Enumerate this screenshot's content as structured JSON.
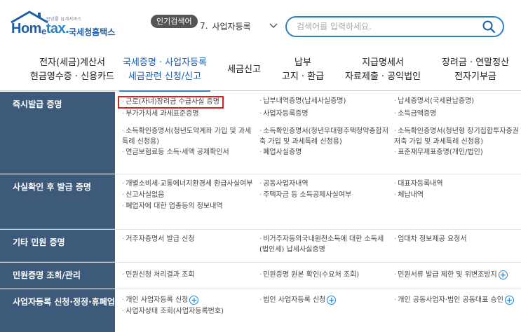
{
  "header": {
    "logo_tagline": "안녕를 납세서비스",
    "logo_brand_home": "Hom",
    "logo_brand_e": "e",
    "logo_brand_tax": "tax.",
    "logo_sub": "국세청홈택스",
    "popular_badge": "인기검색어",
    "popular_number": "7.",
    "popular_term": "사업자등록",
    "search_placeholder": "검색어를 입력하세요."
  },
  "nav": [
    {
      "line1": "전자(세금)계산서",
      "line2": "현금영수증 · 신용카드"
    },
    {
      "line1": "국세증명 · 사업자등록",
      "line2": "세금관련 신청/신고"
    },
    {
      "line1": "세금신고",
      "line2": ""
    },
    {
      "line1": "납부",
      "line2": "고지 · 환급"
    },
    {
      "line1": "지급명세서",
      "line2": "자료제출 · 공익법인"
    },
    {
      "line1": "장려금 · 연말정산",
      "line2": "전자기부금"
    }
  ],
  "sections": [
    {
      "title": "즉시발급 증명",
      "items": [
        "근로(자녀)장려금 수급사실 증명",
        "납부내역증명(납세사실증명)",
        "납세증명서(국세완납증명)",
        "부가가치세 과세표준증명",
        "사업자등록증명",
        "소득금액증명",
        "소득확인증명서(청년도약계좌 가입 및 과세특례 신청용)",
        "소득확인증명서(청년우대형주택청약종합저축 가입 및 과세특례 신청용)",
        "소득확인증명서(청년형 장기집합투자증권저축 가입 및 과세특례 신청용)",
        "연금보험료등 소득·세액 공제확인서",
        "폐업사실증명",
        "표준재무제표증명(개인/법인)"
      ]
    },
    {
      "title": "사실확인 후 발급 증명",
      "items": [
        "개별소비세·교통에너지환경세 환급사실여부",
        "공동사업자내역",
        "대표자등록내역",
        "신고사실없음",
        "주택자금 등 소득공제사실여부",
        "체납내역",
        "폐업자에 대한 업종등의 정보내역",
        "",
        ""
      ]
    },
    {
      "title": "기타 민원 증명",
      "items": [
        "거주자증명서 발급 신청",
        "비거주자등의국내원천소득에 대한 소득세(법인세) 납세사실증명",
        "임대차 정보제공 요청서"
      ]
    },
    {
      "title": "민원증명 조회/관리",
      "items": [
        "민원신청 처리결과 조회",
        "민원증명 원본 확인(수요처 조회)",
        "민원서류 발급 제한 및 위변조방지"
      ]
    },
    {
      "title": "사업자등록 신청·정정·휴폐업",
      "items": [
        "개인 사업자등록 신청",
        "법인 사업자등록 신청",
        "개인 공동사업자·법인 공동대표 승인",
        "사업자상태 조회(사업자등록번호)",
        "",
        ""
      ]
    }
  ],
  "colors": {
    "accent": "#2c82c9",
    "sidebar": "#3d5a7a",
    "highlight_border": "#e02020"
  }
}
